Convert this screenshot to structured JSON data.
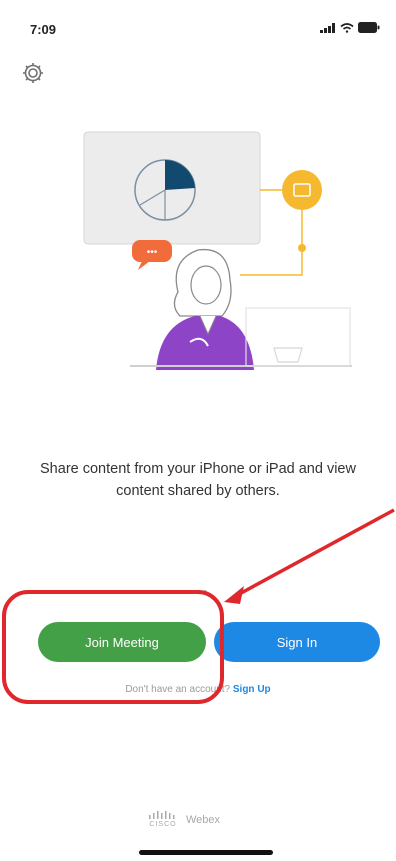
{
  "status_bar": {
    "time": "7:09",
    "icons": [
      "signal-icon",
      "wifi-icon",
      "battery-icon"
    ]
  },
  "settings": {
    "icon": "gear-icon"
  },
  "illustration": {
    "chat_bubble_text": "•••"
  },
  "tagline": "Share content from your iPhone or iPad and view content shared by others.",
  "buttons": {
    "join_label": "Join Meeting",
    "signin_label": "Sign In"
  },
  "signup": {
    "prompt": "Don't have an account?",
    "link": "Sign Up"
  },
  "footer": {
    "cisco_text": "CISCO",
    "product_text": "Webex"
  },
  "colors": {
    "join_green": "#43a047",
    "signin_blue": "#1e88e5",
    "highlight_red": "#e0272b",
    "illustration_orange": "#f5b82e",
    "bubble_orange": "#f26b3a",
    "shirt_purple": "#8e44c7"
  }
}
